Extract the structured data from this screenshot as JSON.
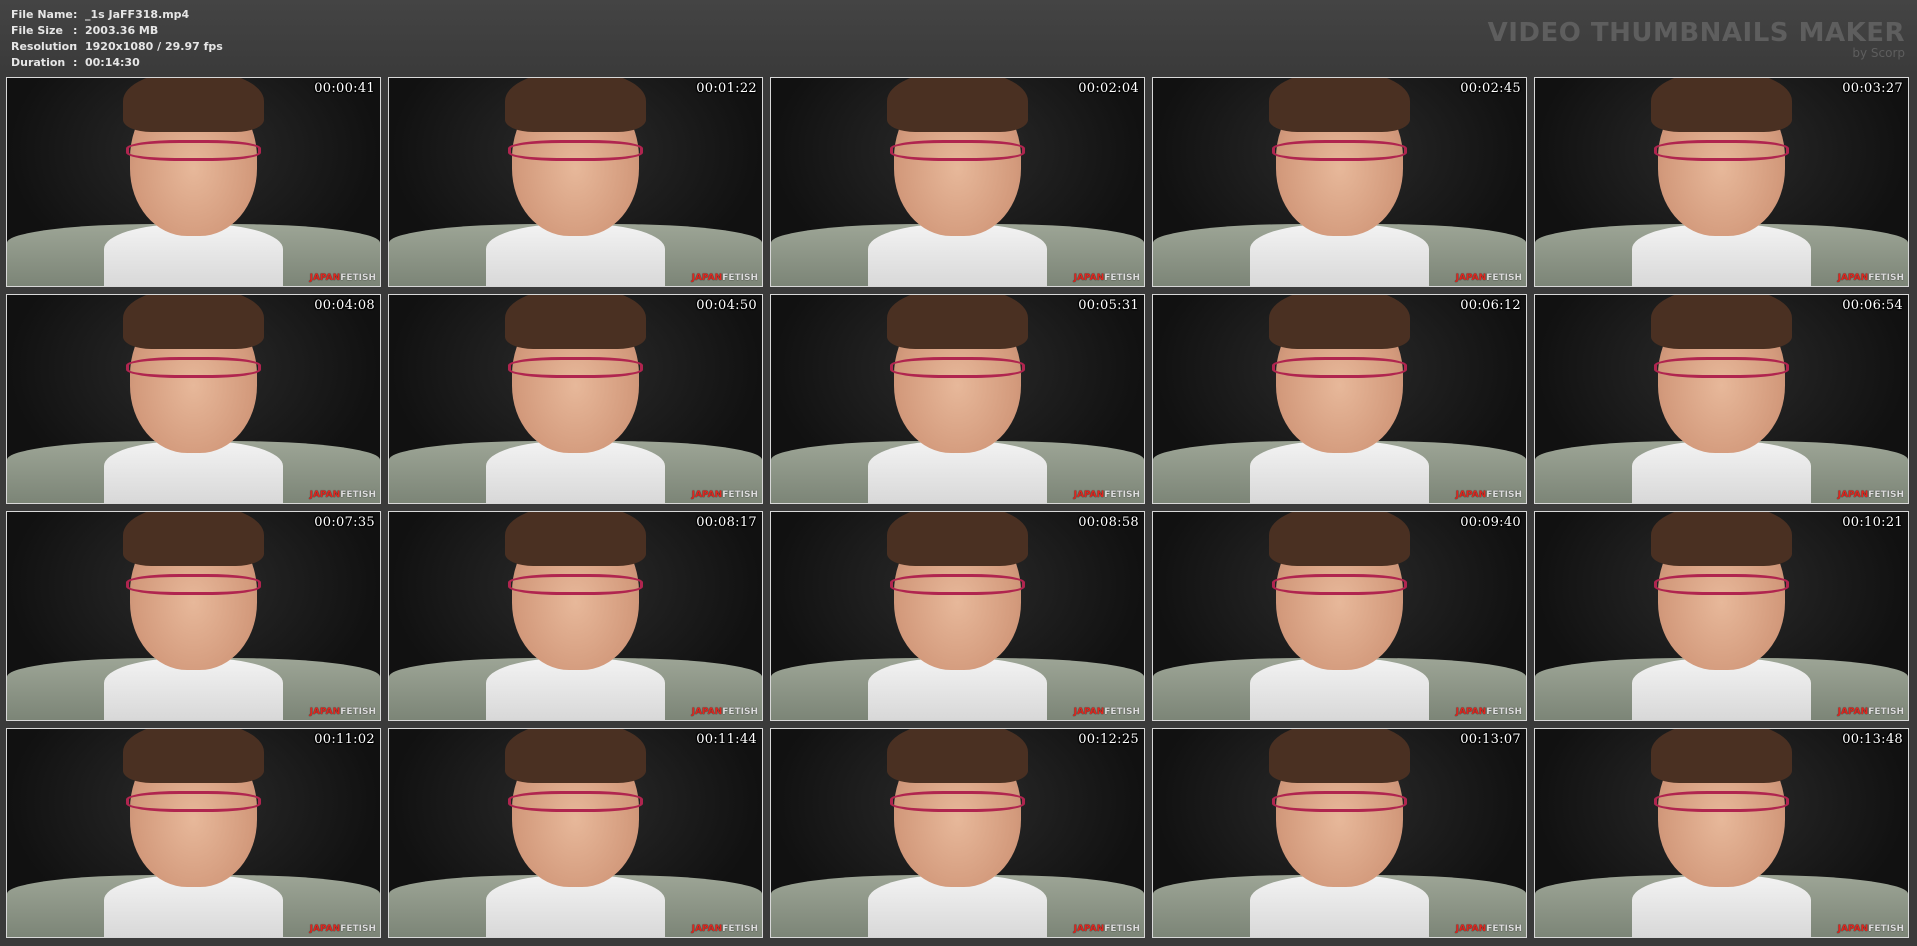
{
  "header": {
    "fields": [
      {
        "key": "File Name",
        "sep": ":",
        "value": "_1s JaFF318.mp4"
      },
      {
        "key": "File Size",
        "sep": ":",
        "value": "2003.36 MB"
      },
      {
        "key": "Resolution",
        "sep": ":",
        "value": "1920x1080 / 29.97 fps"
      },
      {
        "key": "Duration",
        "sep": ":",
        "value": "00:14:30"
      }
    ],
    "brand_title": "VIDEO THUMBNAILS MAKER",
    "brand_sub": "by Scorp"
  },
  "watermark": {
    "part1": "JAPAN",
    "part2": "FETISH"
  },
  "thumbnails": [
    "00:00:41",
    "00:01:22",
    "00:02:04",
    "00:02:45",
    "00:03:27",
    "00:04:08",
    "00:04:50",
    "00:05:31",
    "00:06:12",
    "00:06:54",
    "00:07:35",
    "00:08:17",
    "00:08:58",
    "00:09:40",
    "00:10:21",
    "00:11:02",
    "00:11:44",
    "00:12:25",
    "00:13:07",
    "00:13:48"
  ],
  "colors": {
    "background": "#3a3a3a",
    "frame_border": "#d8d8d8",
    "watermark_red": "#e0261f",
    "glasses": "#b0254f"
  }
}
